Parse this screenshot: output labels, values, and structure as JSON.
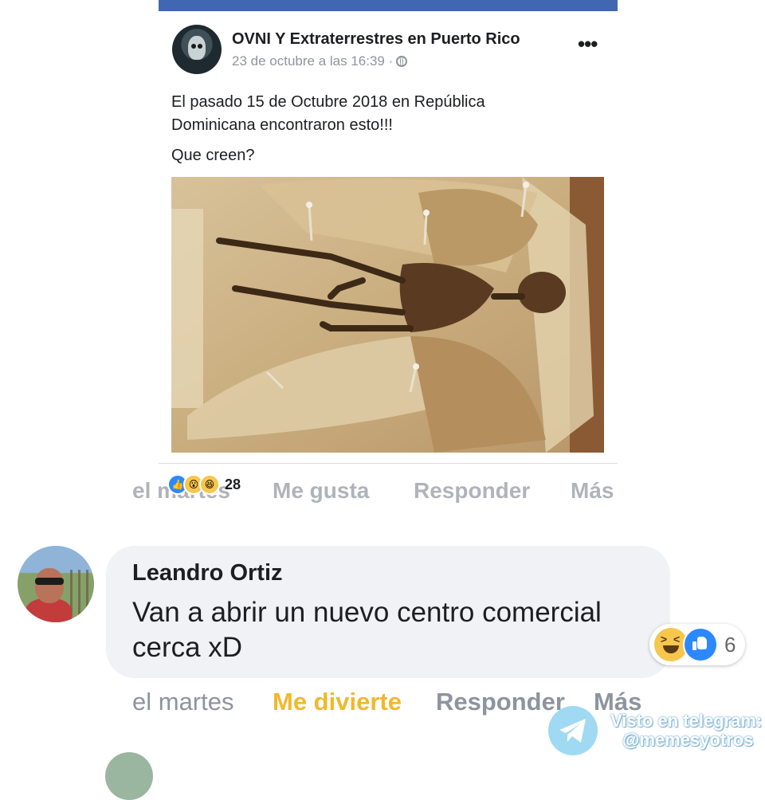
{
  "post": {
    "page_name": "OVNI Y Extraterrestres en Puerto Rico",
    "timestamp": "23 de octubre a las 16:39 ·",
    "text_line1": "El pasado 15 de Octubre 2018 en República",
    "text_line2": "Dominicana encontraron esto!!!",
    "text_line3": "Que creen?",
    "image_icon": "fairy-skeleton-photo",
    "reaction_count": "28",
    "reaction_icons": [
      "like-icon",
      "wow-icon",
      "haha-icon"
    ]
  },
  "faded_actions": {
    "time": "el martes",
    "like": "Me gusta",
    "reply": "Responder",
    "more": "Más"
  },
  "comment": {
    "author": "Leandro Ortiz",
    "text_line1": "Van a abrir un nuevo centro comercial",
    "text_line2": "cerca xD",
    "reaction_count": "6",
    "reaction_icons": [
      "haha-icon",
      "like-icon"
    ]
  },
  "comment_actions": {
    "time": "el martes",
    "reaction": "Me divierte",
    "reply": "Responder",
    "more": "Más"
  },
  "watermark": {
    "line1": "Visto en telegram:",
    "line2": "@memesyotros"
  },
  "colors": {
    "facebook_blue": "#4267b2",
    "haha_yellow": "#f0b92c",
    "muted_gray": "#8d949e"
  }
}
